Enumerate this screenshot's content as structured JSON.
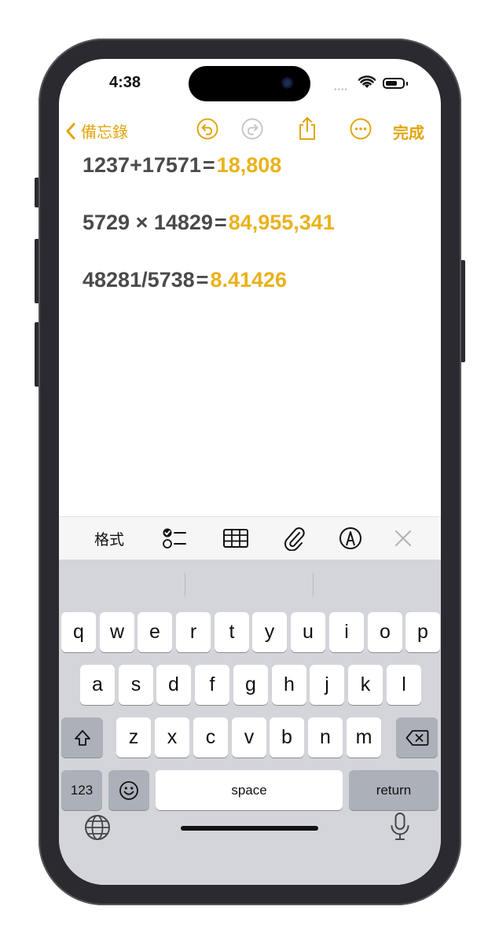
{
  "status_bar": {
    "time": "4:38",
    "signal": "••••"
  },
  "nav": {
    "back_label": "備忘錄",
    "done_label": "完成"
  },
  "note": {
    "lines": [
      {
        "expression": "1237+17571",
        "equals": "=",
        "result": "18,808"
      },
      {
        "expression": "5729 × 14829",
        "equals": "=",
        "result": "84,955,341"
      },
      {
        "expression": "48281/5738",
        "equals": "=",
        "result": "8.41426"
      }
    ]
  },
  "toolbar": {
    "format_label": "格式"
  },
  "keyboard": {
    "row1": [
      "q",
      "w",
      "e",
      "r",
      "t",
      "y",
      "u",
      "i",
      "o",
      "p"
    ],
    "row2": [
      "a",
      "s",
      "d",
      "f",
      "g",
      "h",
      "j",
      "k",
      "l"
    ],
    "row3": [
      "z",
      "x",
      "c",
      "v",
      "b",
      "n",
      "m"
    ],
    "numbers_label": "123",
    "space_label": "space",
    "return_label": "return"
  },
  "colors": {
    "accent": "#e2a510",
    "result": "#e9b21d",
    "text": "#4a4a4c",
    "keyboard_bg": "#d3d5da"
  }
}
